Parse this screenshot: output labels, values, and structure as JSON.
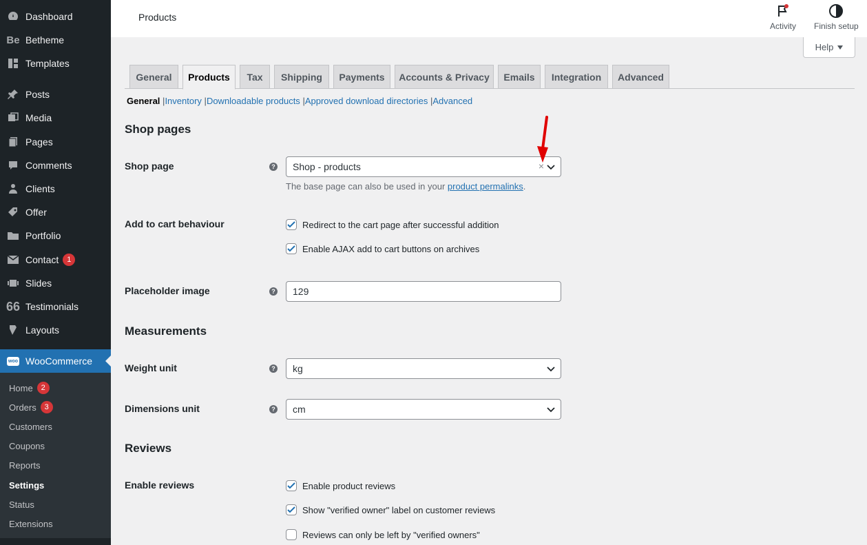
{
  "sidebar": {
    "items": [
      {
        "label": "Dashboard",
        "icon": "dashboard-icon"
      },
      {
        "label": "Betheme",
        "icon": "betheme-icon"
      },
      {
        "label": "Templates",
        "icon": "templates-icon"
      },
      {
        "label": "Posts",
        "icon": "pin-icon"
      },
      {
        "label": "Media",
        "icon": "media-icon"
      },
      {
        "label": "Pages",
        "icon": "pages-icon"
      },
      {
        "label": "Comments",
        "icon": "comments-icon"
      },
      {
        "label": "Clients",
        "icon": "clients-icon"
      },
      {
        "label": "Offer",
        "icon": "offer-icon"
      },
      {
        "label": "Portfolio",
        "icon": "portfolio-icon"
      },
      {
        "label": "Contact",
        "icon": "mail-icon",
        "badge": "1"
      },
      {
        "label": "Slides",
        "icon": "slides-icon"
      },
      {
        "label": "Testimonials",
        "icon": "quote-icon"
      },
      {
        "label": "Layouts",
        "icon": "layouts-icon"
      },
      {
        "label": "WooCommerce",
        "icon": "woo-icon"
      }
    ],
    "betheme_glyph": "Be",
    "woo_glyph": "woo",
    "testimonials_glyph": "66",
    "submenu": [
      {
        "label": "Home",
        "badge": "2"
      },
      {
        "label": "Orders",
        "badge": "3"
      },
      {
        "label": "Customers"
      },
      {
        "label": "Coupons"
      },
      {
        "label": "Reports"
      },
      {
        "label": "Settings"
      },
      {
        "label": "Status"
      },
      {
        "label": "Extensions"
      }
    ]
  },
  "header": {
    "title": "Products",
    "activity_label": "Activity",
    "finish_setup_label": "Finish setup",
    "help_label": "Help"
  },
  "tabs": [
    "General",
    "Products",
    "Tax",
    "Shipping",
    "Payments",
    "Accounts & Privacy",
    "Emails",
    "Integration",
    "Advanced"
  ],
  "active_tab": "Products",
  "subnav": {
    "current": "General",
    "links": [
      "Inventory",
      "Downloadable products",
      "Approved download directories",
      "Advanced"
    ],
    "separator": "|"
  },
  "shop_pages": {
    "section_title": "Shop pages",
    "shop_page_label": "Shop page",
    "shop_page_value": "Shop - products",
    "clear_glyph": "×",
    "shop_page_desc_prefix": "The base page can also be used in your ",
    "shop_page_desc_link": "product permalinks",
    "shop_page_desc_suffix": ".",
    "add_to_cart_label": "Add to cart behaviour",
    "redirect_label": "Redirect to the cart page after successful addition",
    "ajax_label": "Enable AJAX add to cart buttons on archives",
    "placeholder_label": "Placeholder image",
    "placeholder_value": "129"
  },
  "measurements": {
    "section_title": "Measurements",
    "weight_label": "Weight unit",
    "weight_value": "kg",
    "dimensions_label": "Dimensions unit",
    "dimensions_value": "cm"
  },
  "reviews": {
    "section_title": "Reviews",
    "enable_label": "Enable reviews",
    "enable_product_reviews": "Enable product reviews",
    "show_verified": "Show \"verified owner\" label on customer reviews",
    "only_verified": "Reviews can only be left by \"verified owners\""
  },
  "help_tip_glyph": "?",
  "colors": {
    "sidebar_bg": "#1d2327",
    "accent": "#2271b1",
    "badge": "#d63638",
    "arrow": "#e00000"
  }
}
